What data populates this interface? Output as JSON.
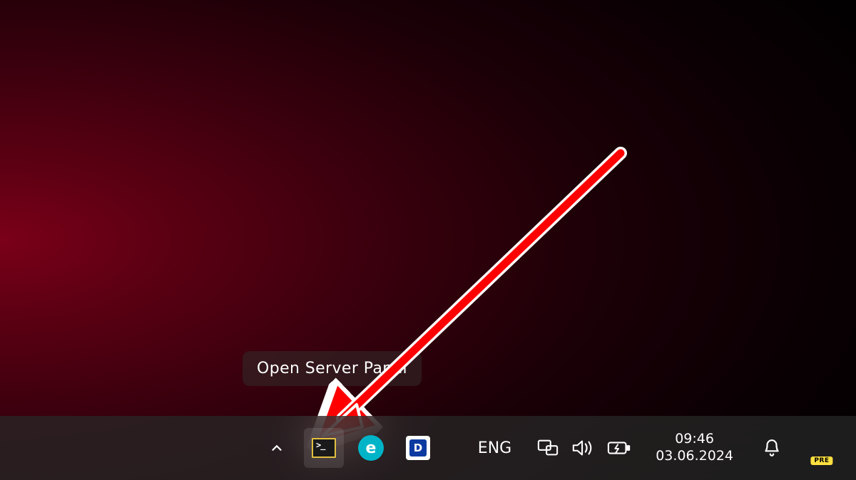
{
  "tooltip": {
    "text": "Open Server Panel"
  },
  "tray": {
    "language": "ENG",
    "e_letter": "e",
    "d_letter": "D",
    "copilot_badge": "PRE"
  },
  "datetime": {
    "time": "09:46",
    "date": "03.06.2024"
  }
}
